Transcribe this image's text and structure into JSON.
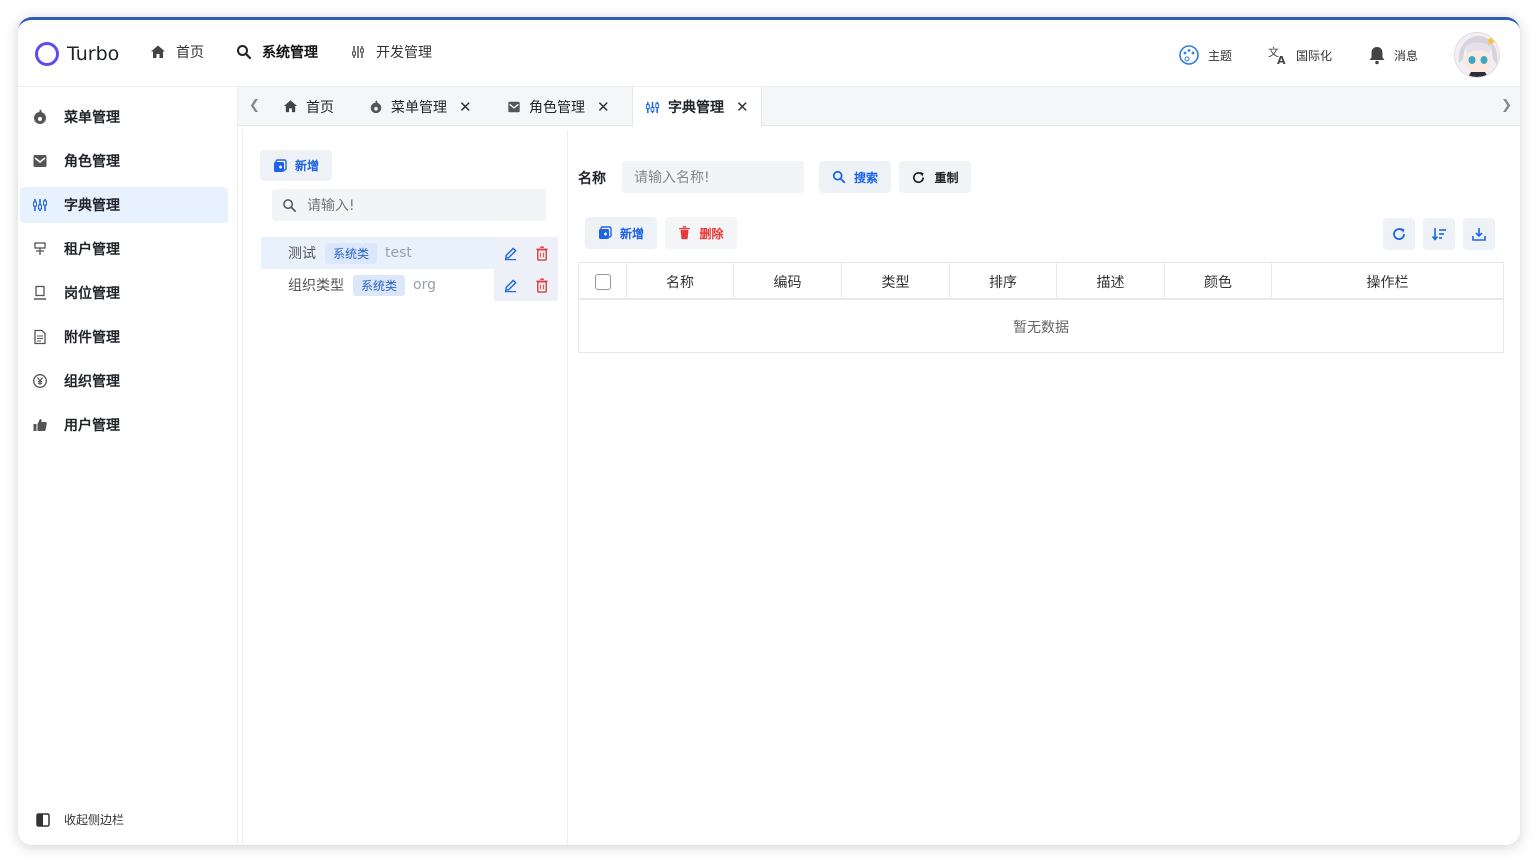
{
  "app": {
    "name": "Turbo"
  },
  "topnav": [
    {
      "label": "首页",
      "icon": "home-icon"
    },
    {
      "label": "系统管理",
      "icon": "search-icon"
    },
    {
      "label": "开发管理",
      "icon": "sliders-icon"
    }
  ],
  "header_right": {
    "theme": "主题",
    "i18n": "国际化",
    "messages": "消息"
  },
  "sidebar": {
    "items": [
      {
        "label": "菜单管理",
        "icon": "fire-icon"
      },
      {
        "label": "角色管理",
        "icon": "mail-icon"
      },
      {
        "label": "字典管理",
        "icon": "dictionary-icon"
      },
      {
        "label": "租户管理",
        "icon": "tenant-icon"
      },
      {
        "label": "岗位管理",
        "icon": "post-icon"
      },
      {
        "label": "附件管理",
        "icon": "file-icon"
      },
      {
        "label": "组织管理",
        "icon": "yen-circle-icon"
      },
      {
        "label": "用户管理",
        "icon": "thumbs-up-icon"
      }
    ],
    "active_index": 2,
    "collapse_label": "收起侧边栏"
  },
  "tabs": [
    {
      "label": "首页"
    },
    {
      "label": "菜单管理"
    },
    {
      "label": "角色管理"
    },
    {
      "label": "字典管理"
    }
  ],
  "left_panel": {
    "add_label": "新增",
    "search_placeholder": "请输入!",
    "items": [
      {
        "name": "测试",
        "tag": "系统类",
        "code": "test"
      },
      {
        "name": "组织类型",
        "tag": "系统类",
        "code": "org"
      }
    ]
  },
  "right_panel": {
    "filter_label": "名称",
    "filter_placeholder": "请输入名称!",
    "search_label": "搜索",
    "reset_label": "重制",
    "add_label": "新增",
    "delete_label": "删除",
    "columns": [
      "名称",
      "编码",
      "类型",
      "排序",
      "描述",
      "颜色",
      "操作栏"
    ],
    "empty_text": "暂无数据"
  },
  "colors": {
    "accent": "#1e64e6",
    "danger": "#e83a3a",
    "active_bg": "#e8f2ff",
    "logo": "#5b4cf5"
  }
}
